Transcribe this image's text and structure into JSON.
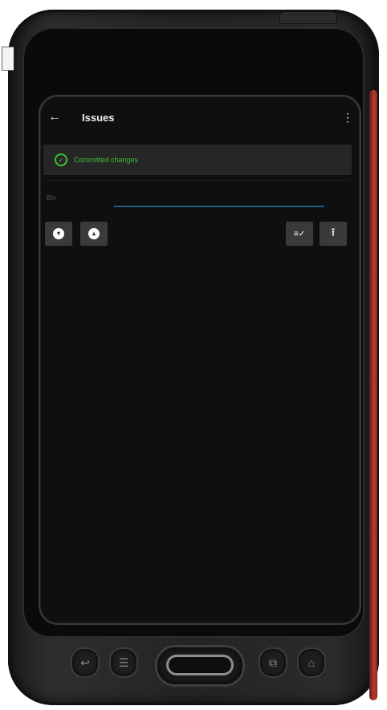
{
  "app_bar": {
    "back_icon": "arrow-left-icon",
    "title": "Issues",
    "menu_icon": "more-vertical-icon"
  },
  "snackbar": {
    "icon": "check-circle-icon",
    "message": "Committed changes",
    "color": "#3dbf3d"
  },
  "form": {
    "bin_label": "Bin",
    "underline_color": "#1c5f86"
  },
  "toolbar": {
    "left_buttons": [
      "chevron-down-icon",
      "chevron-up-icon"
    ],
    "right_buttons": [
      "checklist-icon",
      "upload-icon"
    ]
  },
  "device": {
    "accent_color": "#c0392b",
    "hardware_buttons": [
      "back-icon",
      "menu-icon",
      "scan-trigger",
      "recent-apps-icon",
      "home-icon"
    ]
  }
}
